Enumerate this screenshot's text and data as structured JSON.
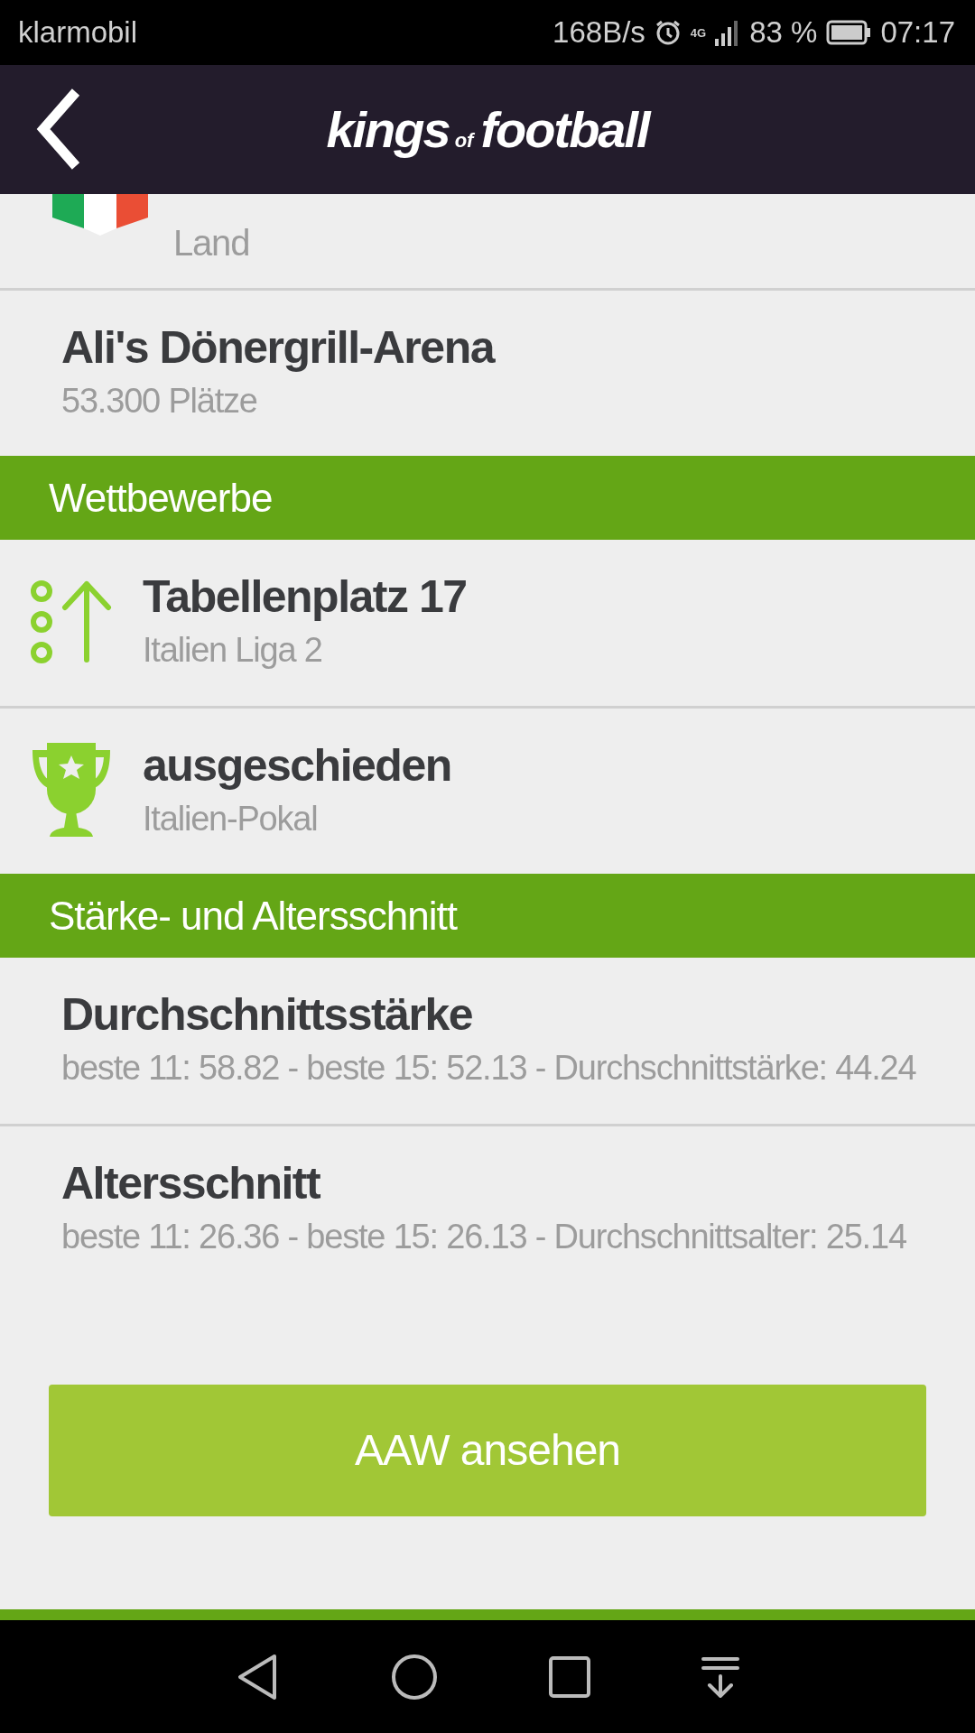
{
  "status_bar": {
    "carrier": "klarmobil",
    "speed": "168B/s",
    "network": "4G",
    "battery": "83 %",
    "time": "07:17"
  },
  "header": {
    "logo": {
      "first": "kings",
      "middle": "of",
      "last": "football"
    }
  },
  "sections": [
    {
      "kind": "plain",
      "rows": [
        {
          "kind": "flag",
          "subtitle": "Land"
        },
        {
          "kind": "text",
          "title": "Ali's Dönergrill-Arena",
          "subtitle": "53.300 Plätze"
        }
      ]
    },
    {
      "kind": "header",
      "title": "Wettbewerbe",
      "rows": [
        {
          "kind": "rank",
          "title": "Tabellenplatz 17",
          "subtitle": "Italien Liga 2"
        },
        {
          "kind": "trophy",
          "title": "ausgeschieden",
          "subtitle": "Italien-Pokal"
        }
      ]
    },
    {
      "kind": "header",
      "title": "Stärke- und Altersschnitt",
      "rows": [
        {
          "kind": "text",
          "title": "Durchschnittsstärke",
          "subtitle": "beste 11: 58.82 - beste 15: 52.13 - Durchschnittstärke: 44.24"
        },
        {
          "kind": "text",
          "title": "Altersschnitt",
          "subtitle": "beste 11: 26.36 - beste 15: 26.13 - Durchschnittsalter: 25.14"
        }
      ]
    }
  ],
  "action_button": "AAW ansehen"
}
